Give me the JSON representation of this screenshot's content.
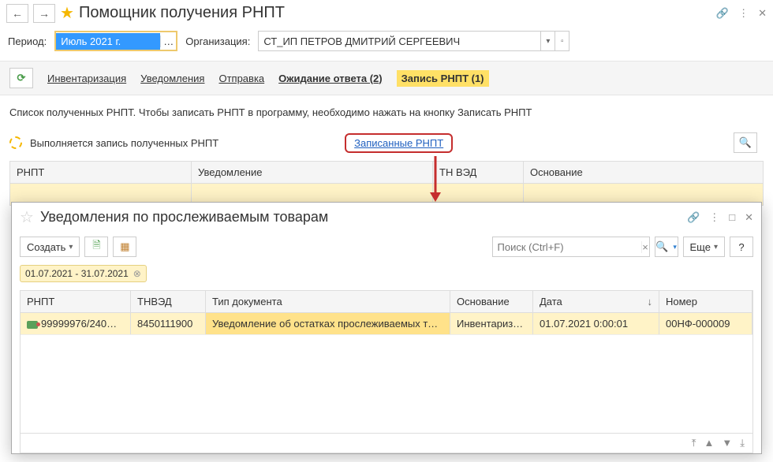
{
  "header": {
    "title": "Помощник получения РНПТ"
  },
  "filters": {
    "period_label": "Период:",
    "period_value": "Июль 2021 г.",
    "org_label": "Организация:",
    "org_value": "СТ_ИП ПЕТРОВ ДМИТРИЙ СЕРГЕЕВИЧ"
  },
  "tabs": {
    "inventory": "Инвентаризация",
    "notifications": "Уведомления",
    "sending": "Отправка",
    "awaiting": "Ожидание ответа (2)",
    "record": "Запись РНПТ (1)"
  },
  "info_text": "Список полученных РНПТ. Чтобы записать РНПТ в программу, необходимо нажать на кнопку Записать РНПТ",
  "status_text": "Выполняется запись полученных РНПТ",
  "link_recorded": "Записанные РНПТ",
  "main_table": {
    "headers": {
      "rnpt": "РНПТ",
      "notif": "Уведомление",
      "tnved": "ТН ВЭД",
      "basis": "Основание"
    }
  },
  "popup": {
    "title": "Уведомления по прослеживаемым товарам",
    "create_label": "Создать",
    "search_placeholder": "Поиск (Ctrl+F)",
    "more_label": "Еще",
    "help_label": "?",
    "date_filter": "01.07.2021 - 31.07.2021",
    "grid_headers": {
      "rnpt": "РНПТ",
      "tnved": "ТНВЭД",
      "doctype": "Тип документа",
      "basis": "Основание",
      "date": "Дата",
      "number": "Номер"
    },
    "row": {
      "rnpt": "99999976/240…",
      "tnved": "8450111900",
      "doctype": "Уведомление об остатках прослеживаемых тов…",
      "basis": "Инвентариз…",
      "date": "01.07.2021 0:00:01",
      "number": "00НФ-000009"
    }
  }
}
